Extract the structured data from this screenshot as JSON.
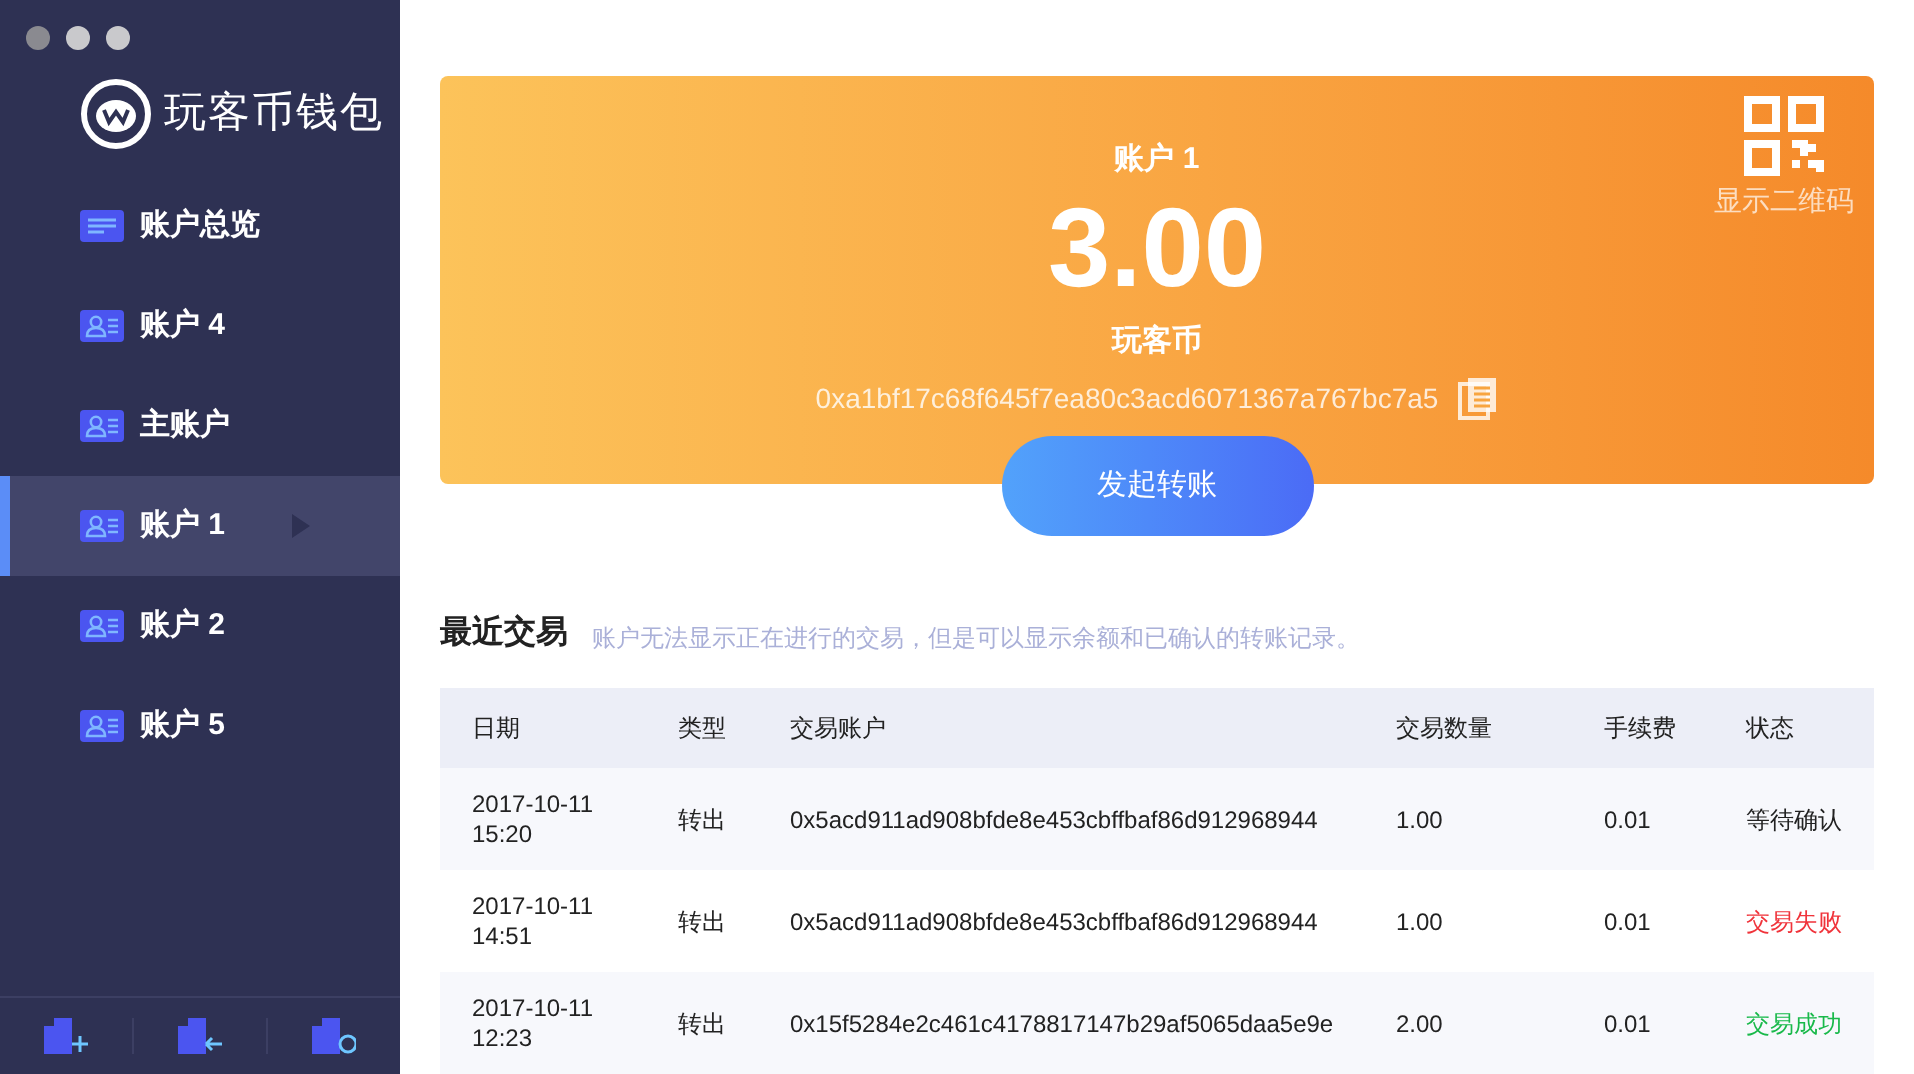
{
  "app": {
    "name": "玩客币钱包"
  },
  "sidebar": {
    "items": [
      {
        "label": "账户总览",
        "kind": "overview",
        "selected": false
      },
      {
        "label": "账户 4",
        "kind": "account",
        "selected": false
      },
      {
        "label": "主账户",
        "kind": "account",
        "selected": false
      },
      {
        "label": "账户 1",
        "kind": "account",
        "selected": true
      },
      {
        "label": "账户 2",
        "kind": "account",
        "selected": false
      },
      {
        "label": "账户 5",
        "kind": "account",
        "selected": false
      }
    ],
    "footer_buttons": [
      {
        "kind": "add"
      },
      {
        "kind": "import"
      },
      {
        "kind": "restore"
      }
    ]
  },
  "account_card": {
    "name": "账户 1",
    "balance": "3.00",
    "currency": "玩客币",
    "address": "0xa1bf17c68f645f7ea80c3acd6071367a767bc7a5",
    "qr_label": "显示二维码"
  },
  "transfer_button": "发起转账",
  "transactions": {
    "title": "最近交易",
    "note": "账户无法显示正在进行的交易，但是可以显示余额和已确认的转账记录。",
    "columns": [
      "日期",
      "类型",
      "交易账户",
      "交易数量",
      "手续费",
      "状态"
    ],
    "rows": [
      {
        "date": "2017-10-11",
        "time": "15:20",
        "type": "转出",
        "account": "0x5acd911ad908bfde8e453cbffbaf86d912968944",
        "amount": "1.00",
        "fee": "0.01",
        "status": "等待确认",
        "color": "#222222"
      },
      {
        "date": "2017-10-11",
        "time": "14:51",
        "type": "转出",
        "account": "0x5acd911ad908bfde8e453cbffbaf86d912968944",
        "amount": "1.00",
        "fee": "0.01",
        "status": "交易失败",
        "color": "#f0333a"
      },
      {
        "date": "2017-10-11",
        "time": "12:23",
        "type": "转出",
        "account": "0x15f5284e2c461c4178817147b29af5065daa5e9e",
        "amount": "2.00",
        "fee": "0.01",
        "status": "交易成功",
        "color": "#19b94a"
      }
    ]
  }
}
